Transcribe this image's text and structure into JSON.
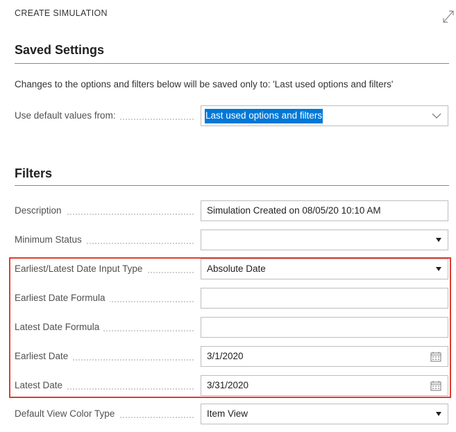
{
  "header": {
    "title": "CREATE SIMULATION",
    "expand_icon": "expand-diagonal-icon"
  },
  "saved_settings": {
    "title": "Saved Settings",
    "info": "Changes to the options and filters below will be saved only to: 'Last used options and filters'",
    "default_label": "Use default values from:",
    "default_value": "Last used options and filters"
  },
  "filters": {
    "title": "Filters",
    "description_label": "Description",
    "description_value": "Simulation Created on 08/05/20 10:10 AM",
    "minimum_status_label": "Minimum Status",
    "minimum_status_value": "",
    "date_input_type_label": "Earliest/Latest Date Input Type",
    "date_input_type_value": "Absolute Date",
    "earliest_formula_label": "Earliest Date Formula",
    "earliest_formula_value": "",
    "latest_formula_label": "Latest Date Formula",
    "latest_formula_value": "",
    "earliest_date_label": "Earliest Date",
    "earliest_date_value": "3/1/2020",
    "latest_date_label": "Latest Date",
    "latest_date_value": "3/31/2020",
    "view_color_type_label": "Default View Color Type",
    "view_color_type_value": "Item View"
  },
  "colors": {
    "highlight_border": "#e33b2c",
    "selection": "#0078d7"
  }
}
